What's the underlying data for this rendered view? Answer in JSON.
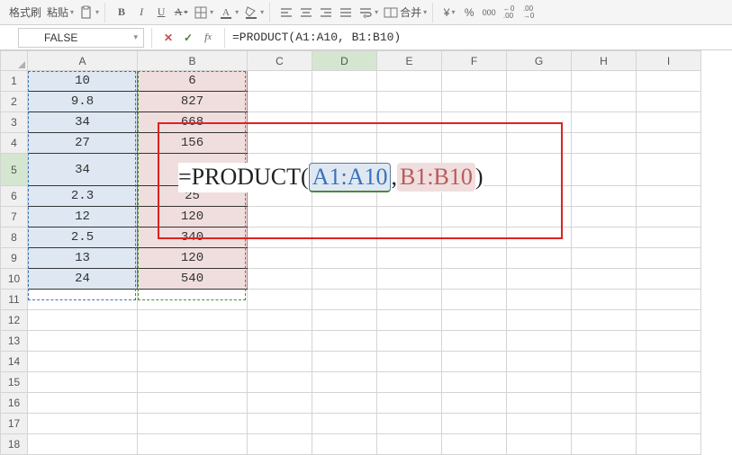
{
  "toolbar": {
    "format_painter": "格式刷",
    "paste": "粘贴",
    "merge": "合并"
  },
  "formula_bar": {
    "name_box": "FALSE",
    "formula_text": "=PRODUCT(A1:A10, B1:B10)"
  },
  "columns": [
    "A",
    "B",
    "C",
    "D",
    "E",
    "F",
    "G",
    "H",
    "I"
  ],
  "rows": [
    "1",
    "2",
    "3",
    "4",
    "5",
    "6",
    "7",
    "8",
    "9",
    "10",
    "11",
    "12",
    "13",
    "14",
    "15",
    "16",
    "17",
    "18"
  ],
  "data": {
    "A": [
      "10",
      "9.8",
      "34",
      "27",
      "34",
      "2.3",
      "12",
      "2.5",
      "13",
      "24"
    ],
    "B": [
      "6",
      "827",
      "668",
      "156",
      "",
      "25",
      "120",
      "340",
      "120",
      "540"
    ]
  },
  "overlay": {
    "eq": "=",
    "fn": "PRODUCT",
    "lp": " (",
    "ref_a": "A1:A10",
    "comma": ",  ",
    "ref_b": "B1:B10",
    "rp": ")"
  },
  "icons": {
    "bold": "B",
    "italic": "I",
    "underline": "U",
    "strike": "A",
    "currency": "¥",
    "percent": "%",
    "thousands": "000",
    "dec_inc": "←0\n.00",
    "dec_dec": ".00\n→0"
  }
}
